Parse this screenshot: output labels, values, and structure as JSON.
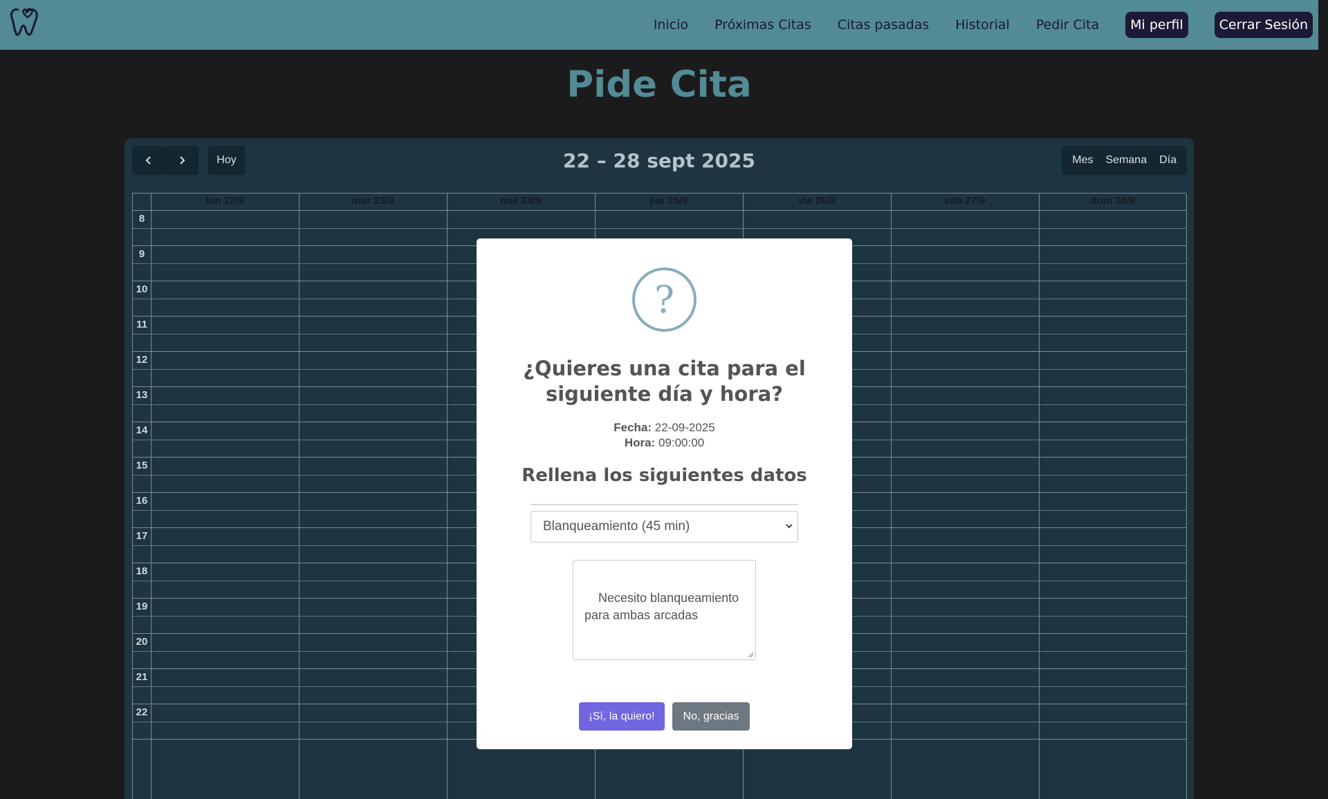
{
  "navbar": {
    "logo_icon": "tooth-heart-logo-icon",
    "links": [
      "Inicio",
      "Próximas Citas",
      "Citas pasadas",
      "Historial",
      "Pedir Cita"
    ],
    "profile_label": "Mi perfil",
    "logout_label": "Cerrar Sesión"
  },
  "page": {
    "title": "Pide Cita"
  },
  "calendar": {
    "prev_icon": "chevron-left-icon",
    "next_icon": "chevron-right-icon",
    "today_label": "Hoy",
    "range_title": "22 – 28 sept 2025",
    "views": [
      "Mes",
      "Semana",
      "Día"
    ],
    "days": [
      "lun 22/9",
      "mar 23/9",
      "mié 24/9",
      "jue 25/9",
      "vie 26/9",
      "sáb 27/9",
      "dom 28/9"
    ],
    "hours": [
      "8",
      "9",
      "10",
      "11",
      "12",
      "13",
      "14",
      "15",
      "16",
      "17",
      "18",
      "19",
      "20",
      "21",
      "22"
    ]
  },
  "modal": {
    "icon": "question-icon",
    "icon_glyph": "?",
    "title": "¿Quieres una cita para el siguiente día y hora?",
    "fecha_label": "Fecha:",
    "fecha_value": "22-09-2025",
    "hora_label": "Hora:",
    "hora_value": "09:00:00",
    "subtitle": "Rellena los siguientes datos",
    "service_selected": "Blanqueamiento (45 min)",
    "notes_value": "Necesito blanqueamiento\npara ambas arcadas",
    "confirm_label": "¡Sí, la quiero!",
    "cancel_label": "No, gracias"
  },
  "colors": {
    "navbar": "#528a95",
    "page_bg": "#1b1b1b",
    "calendar_bg": "#1e3541",
    "confirm": "#7066e0",
    "cancel": "#6e7881",
    "pill": "#1c1a36"
  }
}
